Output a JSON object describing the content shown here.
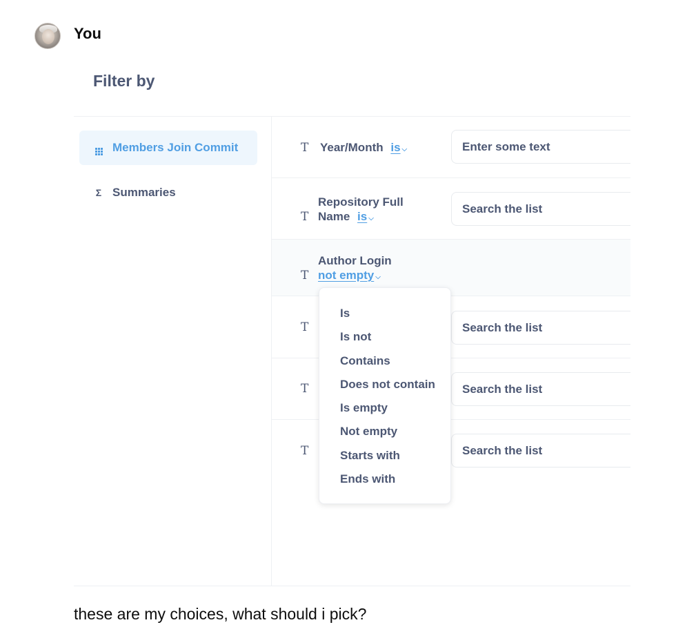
{
  "message": {
    "author": "You",
    "text": "these are my choices, what should i pick?"
  },
  "panel": {
    "title": "Filter by",
    "sidebar": [
      {
        "label": "Members Join Commit",
        "icon": "grid-icon",
        "active": true
      },
      {
        "label": "Summaries",
        "icon": "sigma-icon",
        "active": false
      }
    ]
  },
  "filters": [
    {
      "label": "Year/Month",
      "operator": "is",
      "placeholder": "Enter some text"
    },
    {
      "label_line1": "Repository Full",
      "label_line2": "Name",
      "operator": "is",
      "placeholder": "Search the list"
    },
    {
      "label": "Author Login",
      "operator": "not empty"
    },
    {
      "placeholder": "Search the list"
    },
    {
      "placeholder": "Search the list"
    },
    {
      "placeholder": "Search the list"
    }
  ],
  "field_type_icon": "T",
  "sigma_glyph": "Σ",
  "operator_menu": [
    "Is",
    "Is not",
    "Contains",
    "Does not contain",
    "Is empty",
    "Not empty",
    "Starts with",
    "Ends with"
  ],
  "colors": {
    "accent": "#509ee3",
    "text": "#4c5773",
    "active_bg": "#eef6fd"
  }
}
